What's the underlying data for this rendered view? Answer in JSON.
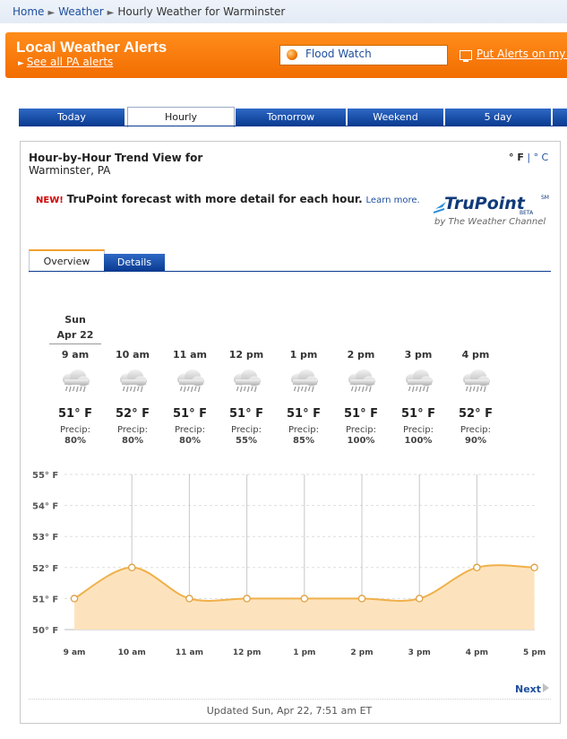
{
  "breadcrumb": {
    "home": "Home",
    "weather": "Weather",
    "current": "Hourly Weather for Warminster"
  },
  "alerts": {
    "title": "Local Weather Alerts",
    "see_all": "See all PA alerts",
    "flood_watch": "Flood Watch",
    "put_alerts": "Put Alerts on my D"
  },
  "tabs": [
    "Today",
    "Hourly",
    "Tomorrow",
    "Weekend",
    "5 day"
  ],
  "active_tab": "Hourly",
  "panel": {
    "title": "Hour-by-Hour Trend View for",
    "location": "Warminster, PA",
    "unit_f": "° F",
    "unit_sep": "|",
    "unit_c": "° C",
    "promo_new": "NEW!",
    "promo_text": "TruPoint forecast with more detail for each hour.",
    "promo_link": "Learn more.",
    "logo_main": "TruPoint",
    "logo_sm": "SM",
    "logo_beta": "BETA",
    "logo_by": "by The Weather Channel"
  },
  "subtabs": [
    "Overview",
    "Details"
  ],
  "day": {
    "name": "Sun",
    "date": "Apr 22"
  },
  "hours": [
    {
      "time": "9 am",
      "temp": "51° F",
      "precip_label": "Precip:",
      "precip": "80%",
      "icon": "rain-cloud-icon"
    },
    {
      "time": "10 am",
      "temp": "52° F",
      "precip_label": "Precip:",
      "precip": "80%",
      "icon": "rain-cloud-icon"
    },
    {
      "time": "11 am",
      "temp": "51° F",
      "precip_label": "Precip:",
      "precip": "80%",
      "icon": "rain-cloud-icon"
    },
    {
      "time": "12 pm",
      "temp": "51° F",
      "precip_label": "Precip:",
      "precip": "55%",
      "icon": "rain-cloud-icon"
    },
    {
      "time": "1 pm",
      "temp": "51° F",
      "precip_label": "Precip:",
      "precip": "85%",
      "icon": "rain-cloud-icon"
    },
    {
      "time": "2 pm",
      "temp": "51° F",
      "precip_label": "Precip:",
      "precip": "100%",
      "icon": "rain-cloud-icon"
    },
    {
      "time": "3 pm",
      "temp": "51° F",
      "precip_label": "Precip:",
      "precip": "100%",
      "icon": "rain-cloud-icon"
    },
    {
      "time": "4 pm",
      "temp": "52° F",
      "precip_label": "Precip:",
      "precip": "90%",
      "icon": "rain-cloud-icon"
    }
  ],
  "chart_data": {
    "type": "area",
    "categories": [
      "9 am",
      "10 am",
      "11 am",
      "12 pm",
      "1 pm",
      "2 pm",
      "3 pm",
      "4 pm",
      "5 pm"
    ],
    "values": [
      51,
      52,
      51,
      51,
      51,
      51,
      51,
      52,
      52
    ],
    "y_ticks": [
      "55° F",
      "54° F",
      "53° F",
      "52° F",
      "51° F",
      "50° F"
    ],
    "ylim": [
      50,
      55
    ],
    "grid": true,
    "line_color": "#f0b04a",
    "fill_color": "#fde3bd"
  },
  "footer": {
    "next": "Next",
    "updated": "Updated Sun, Apr 22, 7:51 am ET"
  },
  "colors": {
    "brand_orange": "#f57c00",
    "tab_blue": "#0a3b91",
    "link_blue": "#1f4f9e"
  }
}
